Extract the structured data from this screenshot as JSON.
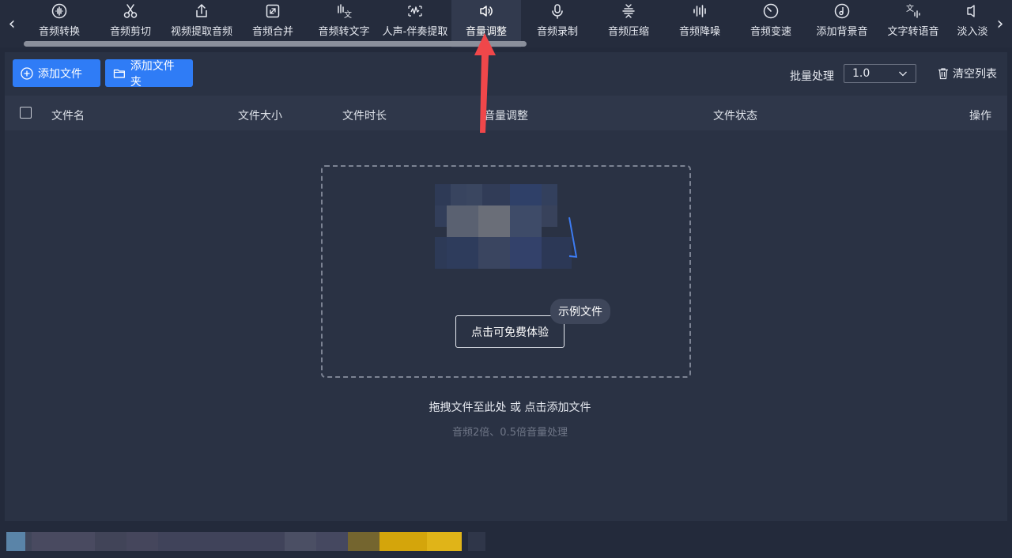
{
  "nav": {
    "left_arrow": "‹",
    "right_arrow": "›"
  },
  "toolbar": {
    "items": [
      {
        "label": "音频转换",
        "icon": "waveform-circle-icon"
      },
      {
        "label": "音频剪切",
        "icon": "scissors-icon"
      },
      {
        "label": "视频提取音频",
        "icon": "upload-share-icon"
      },
      {
        "label": "音频合并",
        "icon": "merge-expand-icon"
      },
      {
        "label": "音频转文字",
        "icon": "speech-to-text-icon"
      },
      {
        "label": "人声-伴奏提取",
        "icon": "vocal-extract-icon"
      },
      {
        "label": "音量调整",
        "icon": "speaker-icon",
        "active": true
      },
      {
        "label": "音频录制",
        "icon": "microphone-icon"
      },
      {
        "label": "音频压缩",
        "icon": "compress-icon"
      },
      {
        "label": "音频降噪",
        "icon": "noise-bars-icon"
      },
      {
        "label": "音频变速",
        "icon": "speedometer-icon"
      },
      {
        "label": "添加背景音",
        "icon": "music-note-icon"
      },
      {
        "label": "文字转语音",
        "icon": "text-to-speech-icon"
      },
      {
        "label": "淡入淡",
        "icon": "fade-icon"
      }
    ]
  },
  "actions": {
    "add_file": "添加文件",
    "add_folder": "添加文件夹",
    "batch_label": "批量处理",
    "batch_value": "1.0",
    "clear_list": "清空列表"
  },
  "table": {
    "columns": [
      "文件名",
      "文件大小",
      "文件时长",
      "音量调整",
      "文件状态",
      "操作"
    ]
  },
  "dropzone": {
    "try_button": "点击可免费体验",
    "sample_badge": "示例文件",
    "hint": "拖拽文件至此处 或 点击添加文件",
    "sub_hint": "音频2倍、0.5倍音量处理"
  },
  "colors": {
    "accent": "#2f7cf6",
    "pointer": "#f0474a",
    "background": "#232a3b",
    "panel": "#2a3244"
  }
}
